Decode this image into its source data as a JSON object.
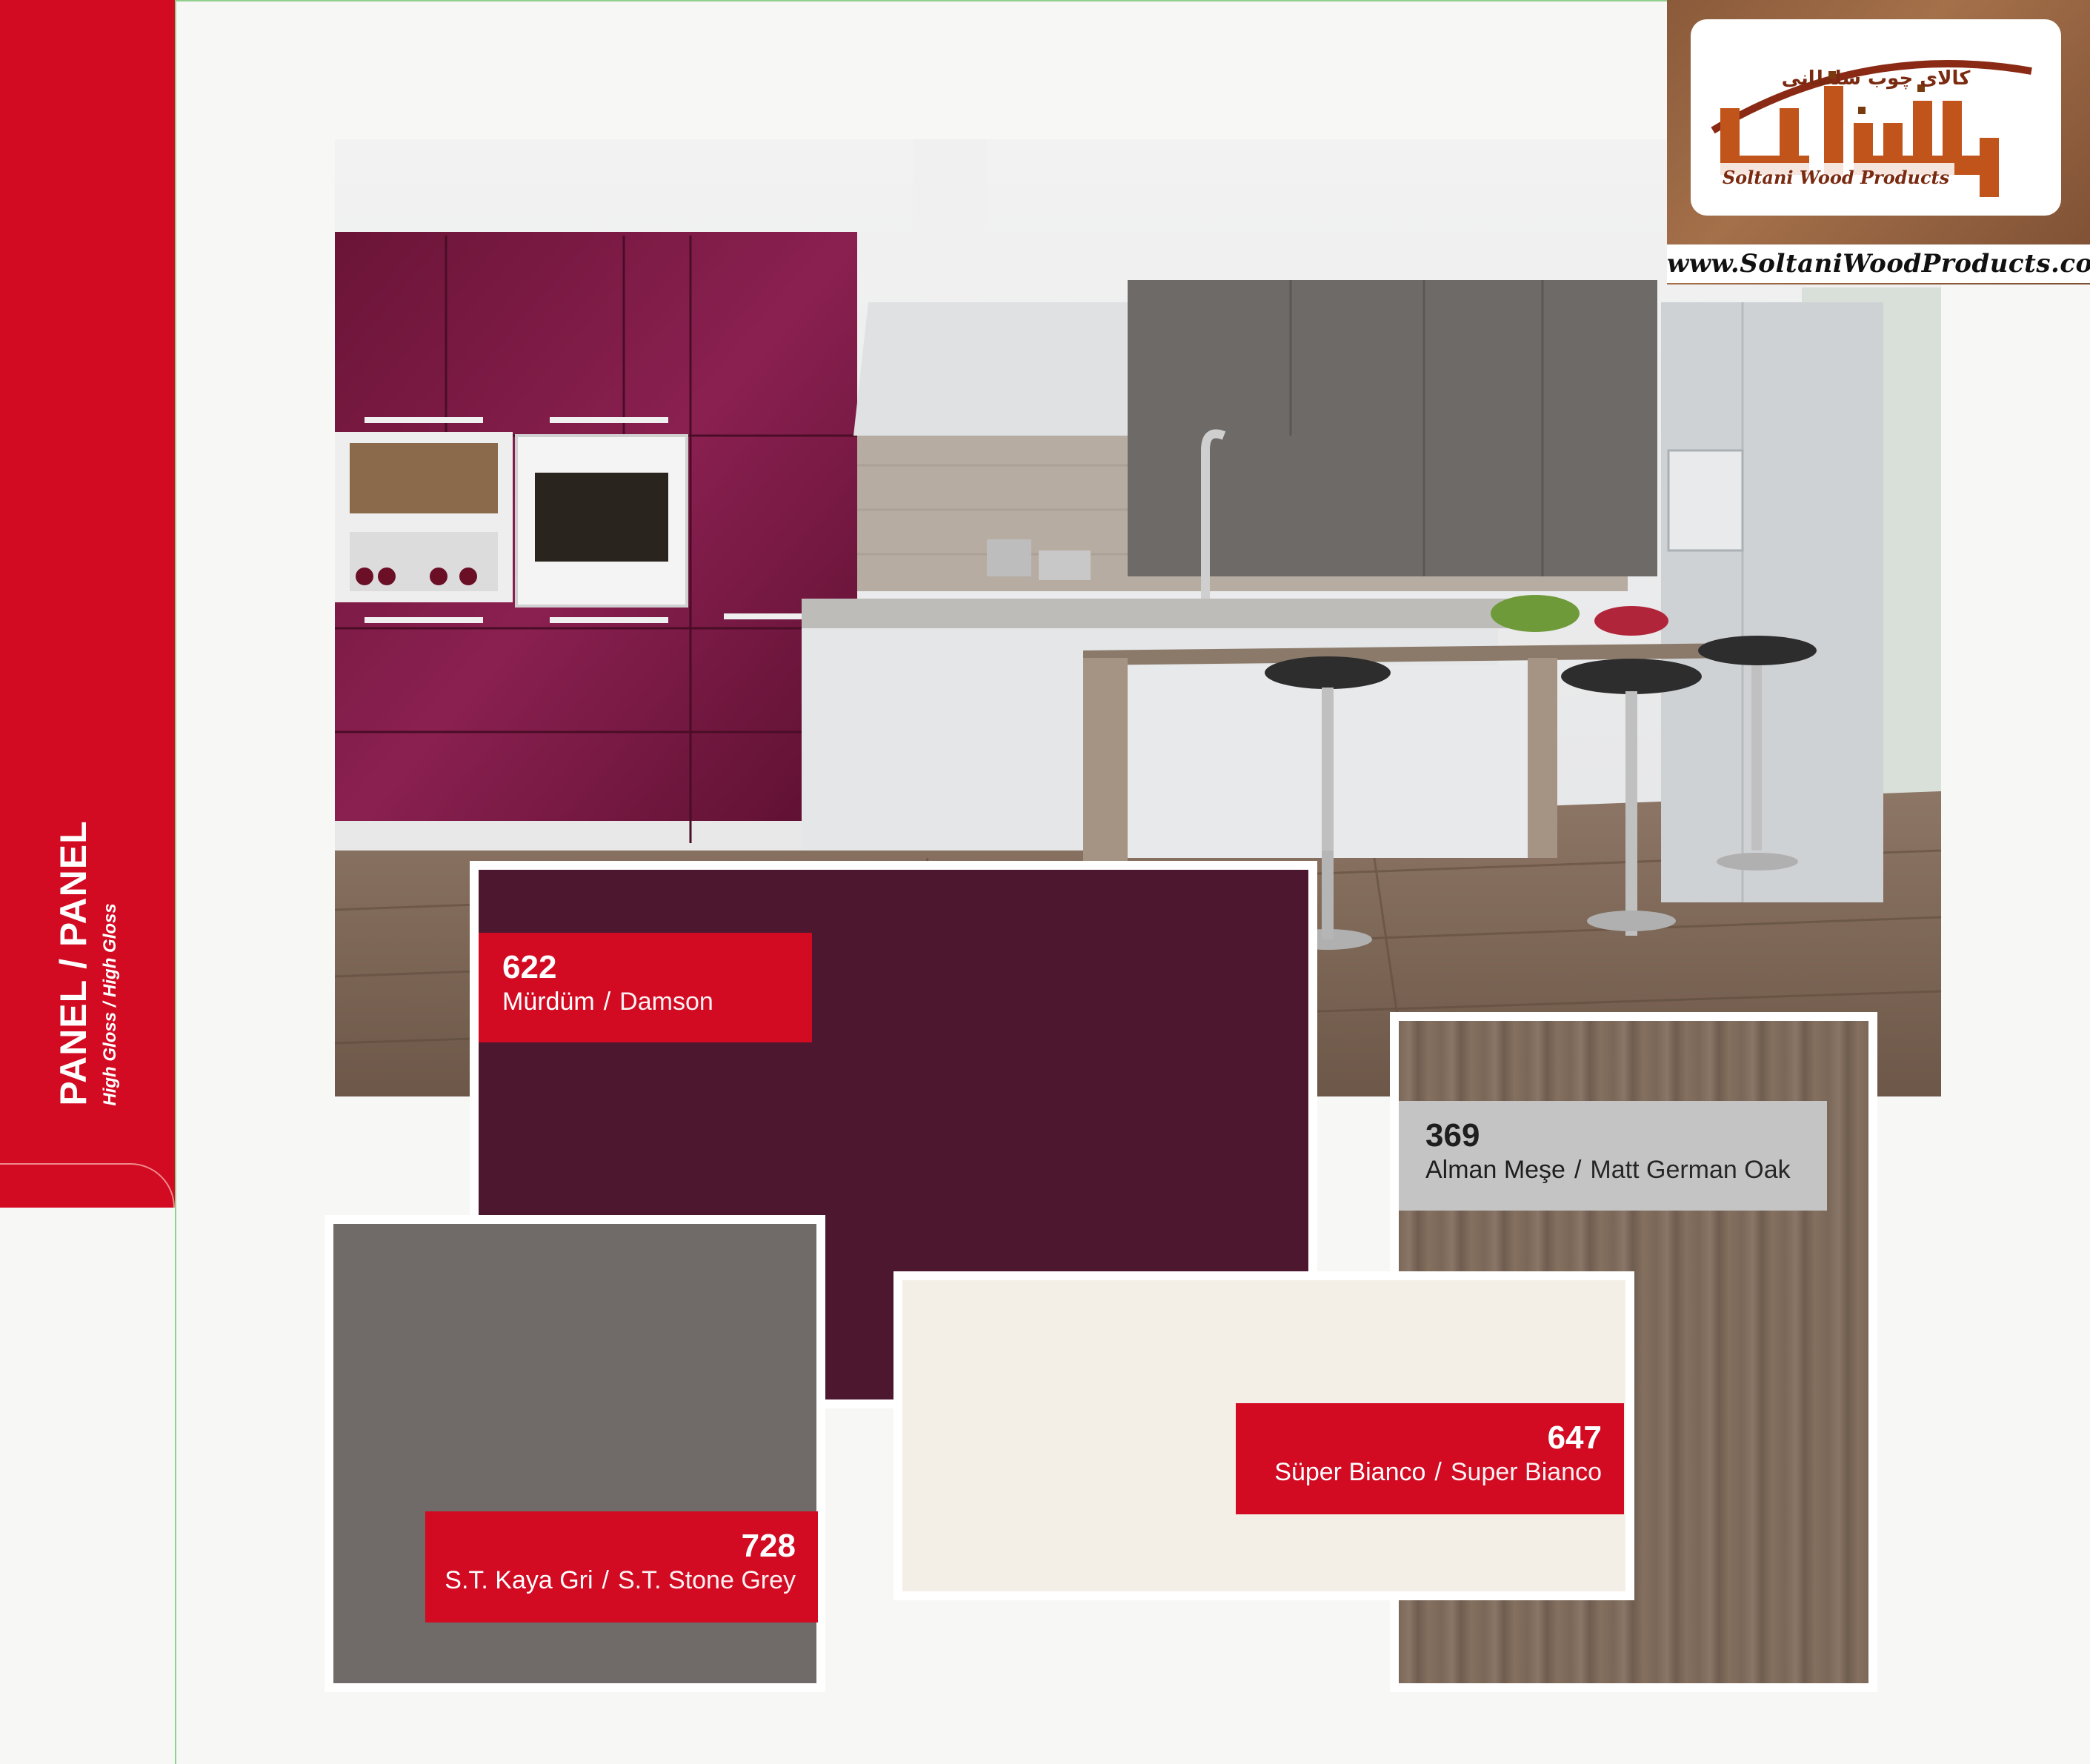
{
  "sidebar": {
    "title": "PANEL / PANEL",
    "subtitle": "High Gloss / High Gloss",
    "accent_color": "#d20a22"
  },
  "photo": {
    "description_icon": "kitchen-photo"
  },
  "swatches": [
    {
      "code": "622",
      "name_tr": "Mürdüm",
      "name_en": "Damson",
      "color": "#4d1730"
    },
    {
      "code": "369",
      "name_tr": "Alman Meşe",
      "name_en": "Matt German Oak",
      "color": "#7d6a5c"
    },
    {
      "code": "728",
      "name_tr": "S.T. Kaya Gri",
      "name_en": "S.T. Stone Grey",
      "color": "#706b68"
    },
    {
      "code": "647",
      "name_tr": "Süper Bianco",
      "name_en": "Super Bianco",
      "color": "#f4efe6"
    }
  ],
  "logo": {
    "persian_text": "کالای چوب سلطانی",
    "brand_text": "Soltani Wood Products",
    "url": "www.SoltaniWoodProducts.com"
  }
}
